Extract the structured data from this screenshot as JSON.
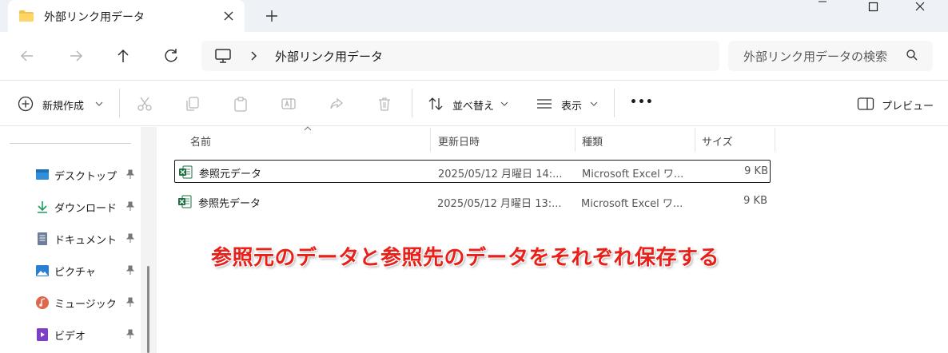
{
  "window": {
    "tab_title": "外部リンク用データ",
    "new_tab_label": "+"
  },
  "nav": {
    "address": "外部リンク用データ",
    "search_placeholder": "外部リンク用データの検索"
  },
  "toolbar": {
    "new_label": "新規作成",
    "sort_label": "並べ替え",
    "view_label": "表示",
    "more_label": "•••",
    "preview_label": "プレビュー"
  },
  "sidebar": {
    "items": [
      {
        "label": "デスクトップ",
        "icon": "desktop-icon"
      },
      {
        "label": "ダウンロード",
        "icon": "download-icon"
      },
      {
        "label": "ドキュメント",
        "icon": "document-icon"
      },
      {
        "label": "ピクチャ",
        "icon": "pictures-icon"
      },
      {
        "label": "ミュージック",
        "icon": "music-icon"
      },
      {
        "label": "ビデオ",
        "icon": "video-icon"
      }
    ]
  },
  "file_list": {
    "columns": [
      "名前",
      "更新日時",
      "種類",
      "サイズ"
    ],
    "rows": [
      {
        "name": "参照元データ",
        "modified": "2025/05/12 月曜日 14:...",
        "type": "Microsoft Excel ワ...",
        "size": "9 KB",
        "selected": true
      },
      {
        "name": "参照先データ",
        "modified": "2025/05/12 月曜日 13:...",
        "type": "Microsoft Excel ワ...",
        "size": "9 KB",
        "selected": false
      }
    ]
  },
  "annotation": "参照元のデータと参照先のデータをそれぞれ保存する",
  "colors": {
    "annotation": "#e8201a",
    "excel_green": "#1d6f42",
    "folder_yellow": "#f4c342"
  }
}
